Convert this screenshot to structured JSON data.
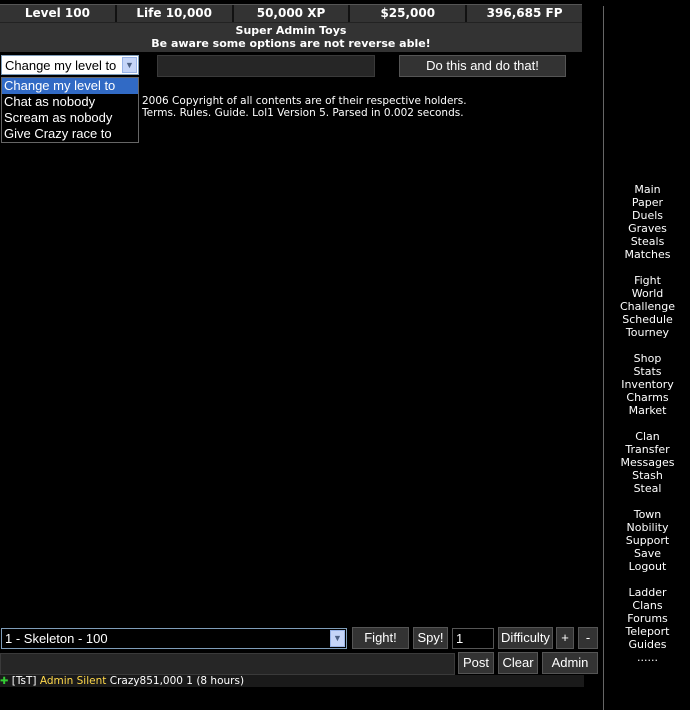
{
  "stats": {
    "level": "Level 100",
    "life": "Life 10,000",
    "xp": "50,000 XP",
    "money": "$25,000",
    "fp": "396,685 FP"
  },
  "toys": {
    "title": "Super Admin Toys",
    "warning": "Be aware some options are not reverse able!"
  },
  "admin_action": {
    "selected": "Change my level to",
    "options": [
      "Change my level to",
      "Chat as nobody",
      "Scream as nobody",
      "Give Crazy race to"
    ],
    "value": "",
    "submit": "Do this and do that!"
  },
  "footer": {
    "line1": "2006 Copyright of all contents are of their respective holders.",
    "line2": "Terms. Rules. Guide. Lol1 Version 5. Parsed in 0.002 seconds."
  },
  "nav": {
    "g1": [
      "Main",
      "Paper",
      "Duels",
      "Graves",
      "Steals",
      "Matches"
    ],
    "g2": [
      "Fight",
      "World",
      "Challenge",
      "Schedule",
      "Tourney"
    ],
    "g3": [
      "Shop",
      "Stats",
      "Inventory",
      "Charms",
      "Market"
    ],
    "g4": [
      "Clan",
      "Transfer",
      "Messages",
      "Stash",
      "Steal"
    ],
    "g5": [
      "Town",
      "Nobility",
      "Support",
      "Save",
      "Logout"
    ],
    "g6": [
      "Ladder",
      "Clans",
      "Forums",
      "Teleport",
      "Guides",
      "......"
    ]
  },
  "fight": {
    "monster": "1 - Skeleton - 100",
    "fight_label": "Fight!",
    "spy_label": "Spy!",
    "count": "1",
    "difficulty_label": "Difficulty",
    "plus": "+",
    "minus": "-"
  },
  "chat": {
    "input": "",
    "post": "Post",
    "clear": "Clear",
    "admin": "Admin",
    "message": {
      "tag": "[TsT]",
      "user": "Admin Silent",
      "text": "Crazy851,000 1 (8 hours)"
    }
  },
  "colors": {
    "selection": "#316ac5",
    "username": "#ffd84a",
    "bar": "#333333"
  }
}
